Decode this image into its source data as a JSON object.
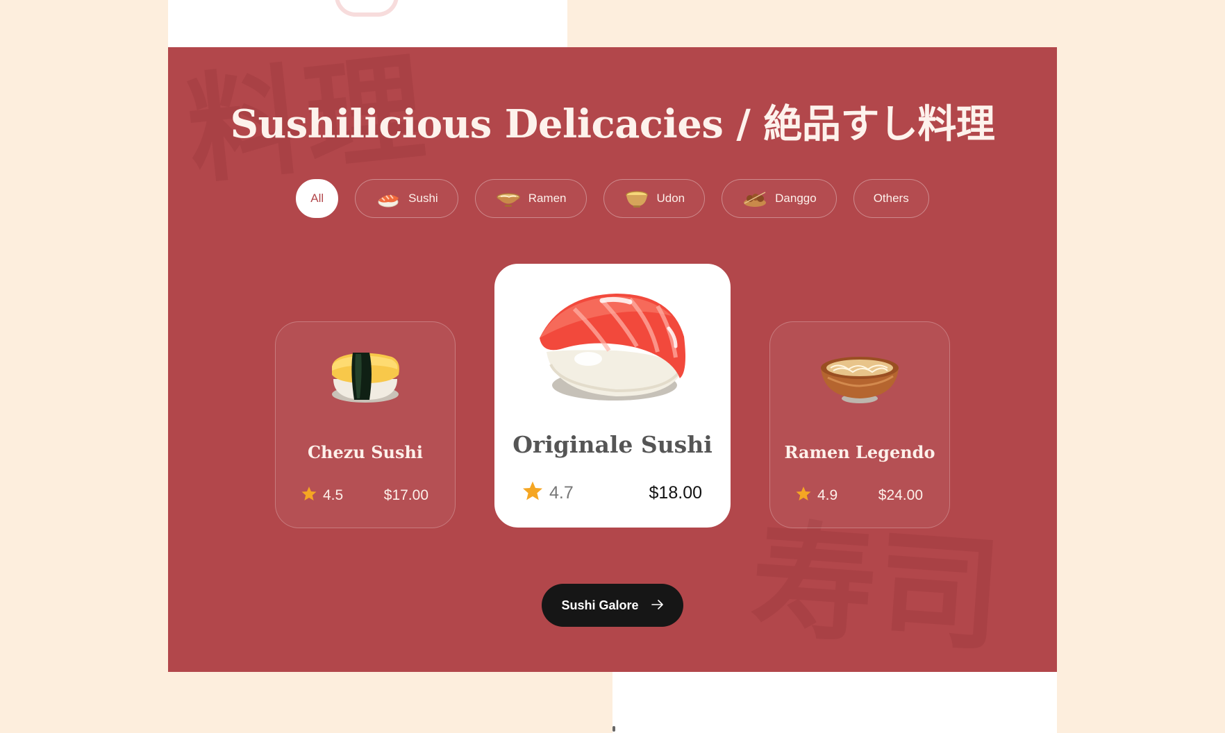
{
  "section": {
    "title": "Sushilicious Delicacies / 絶品すし料理",
    "watermarks": [
      "料理",
      "寿司"
    ]
  },
  "filters": [
    {
      "label": "All",
      "icon": "",
      "active": true
    },
    {
      "label": "Sushi",
      "icon": "sushi-icon",
      "active": false
    },
    {
      "label": "Ramen",
      "icon": "ramen-bowl-icon",
      "active": false
    },
    {
      "label": "Udon",
      "icon": "udon-bowl-icon",
      "active": false
    },
    {
      "label": "Danggo",
      "icon": "danggo-plate-icon",
      "active": false
    },
    {
      "label": "Others",
      "icon": "",
      "active": false
    }
  ],
  "cards": {
    "left": {
      "name": "Chezu Sushi",
      "rating": "4.5",
      "price": "$17.00",
      "image": "tamago-sushi-image"
    },
    "center": {
      "name": "Originale Sushi",
      "rating": "4.7",
      "price": "$18.00",
      "image": "salmon-nigiri-image"
    },
    "right": {
      "name": "Ramen Legendo",
      "rating": "4.9",
      "price": "$24.00",
      "image": "ramen-bowl-image"
    }
  },
  "cta": {
    "label": "Sushi Galore",
    "icon": "arrow-right-icon"
  },
  "colors": {
    "page_bg": "#fdeedd",
    "hero_bg": "#b2474b",
    "card_white": "#ffffff",
    "star": "#f5a623",
    "cta_bg": "#161616"
  }
}
